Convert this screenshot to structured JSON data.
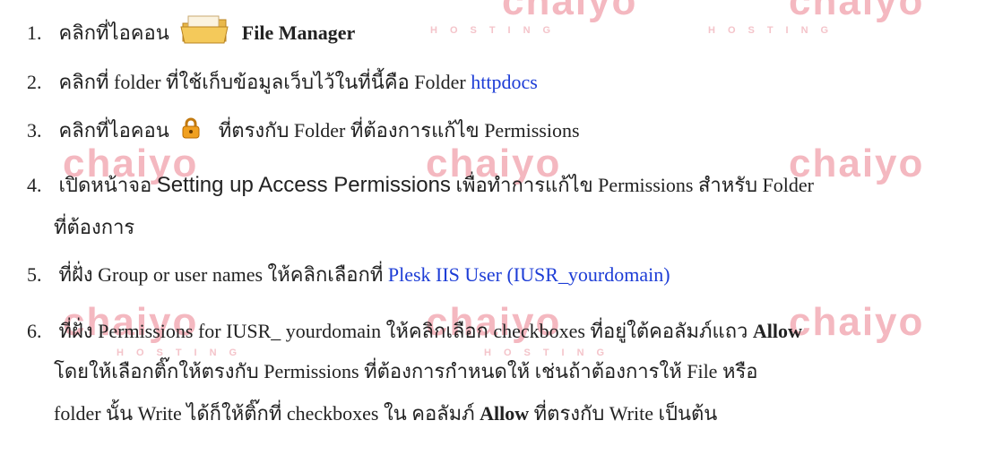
{
  "steps": [
    {
      "num": "1.",
      "prefix": "คลิกที่ไอคอน",
      "icon": "file-manager-folder-icon",
      "bold_text": "File Manager"
    },
    {
      "num": "2.",
      "text": "คลิกที่ folder ที่ใช้เก็บข้อมูลเว็บไว้ในที่นี้คือ Folder",
      "link": "httpdocs"
    },
    {
      "num": "3.",
      "prefix": "คลิกที่ไอคอน",
      "icon": "lock-icon",
      "suffix": "ที่ตรงกับ Folder ที่ต้องการแก้ไข Permissions"
    },
    {
      "num": "4.",
      "prefix": "เปิดหน้าจอ",
      "highlight": "Setting up Access Permissions",
      "suffix": "เพื่อทำการแก้ไข Permissions สำหรับ Folder",
      "line2": "ที่ต้องการ"
    },
    {
      "num": "5.",
      "text": "ที่ฝั่ง Group or user names  ให้คลิกเลือกที่",
      "link": "Plesk IIS User (IUSR_yourdomain)"
    },
    {
      "num": "6.",
      "text": "ที่ฝั่ง Permissions for IUSR_ yourdomain ให้คลิกเลือก checkboxes ที่อยู่ใต้คอลัมภ์แถว",
      "bold_text": "Allow",
      "line2": "โดยให้เลือกติ๊กให้ตรงกับ Permissions ที่ต้องการกำหนดให้  เช่นถ้าต้องการให้ File หรือ",
      "line3_prefix": "folder นั้น Write ได้ก็ให้ติ๊กที่ checkboxes ใน คอลัมภ์",
      "line3_bold": "Allow",
      "line3_suffix": "ที่ตรงกับ Write  เป็นต้น"
    }
  ],
  "watermark": {
    "logo": "chaiyo",
    "sub": "HOSTING"
  },
  "colors": {
    "link": "#1d3dd6",
    "watermark": "#f4b8c0"
  }
}
